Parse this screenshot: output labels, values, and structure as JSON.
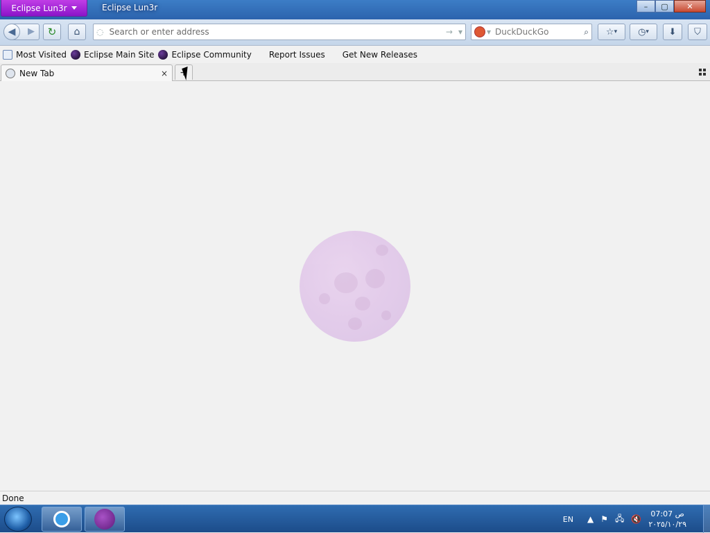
{
  "window": {
    "app_menu_label": "Eclipse Lun3r",
    "title": "Eclipse Lun3r",
    "controls": {
      "minimize": "–",
      "maximize": "▢",
      "close": "✕"
    }
  },
  "navbar": {
    "url_placeholder": "Search or enter address",
    "search_placeholder": "DuckDuckGo"
  },
  "bookmarks": [
    {
      "label": "Most Visited",
      "icon": "most-visited-icon"
    },
    {
      "label": "Eclipse Main Site",
      "icon": "eclipse-icon"
    },
    {
      "label": "Eclipse Community",
      "icon": "eclipse-icon"
    },
    {
      "label": "Report Issues",
      "icon": "blank-page-icon"
    },
    {
      "label": "Get New Releases",
      "icon": "blank-page-icon"
    }
  ],
  "tabs": [
    {
      "label": "New Tab",
      "close": "×"
    }
  ],
  "new_tab_symbol": "+",
  "status": {
    "text": "Done"
  },
  "taskbar": {
    "language": "EN",
    "clock_time": "07:07 ص",
    "clock_date": "٢٠٢٥/١٠/٢٩"
  },
  "colors": {
    "app_menu": "#a22ad6",
    "titlebar": "#3671b8",
    "moon": "#e3cbe9"
  }
}
